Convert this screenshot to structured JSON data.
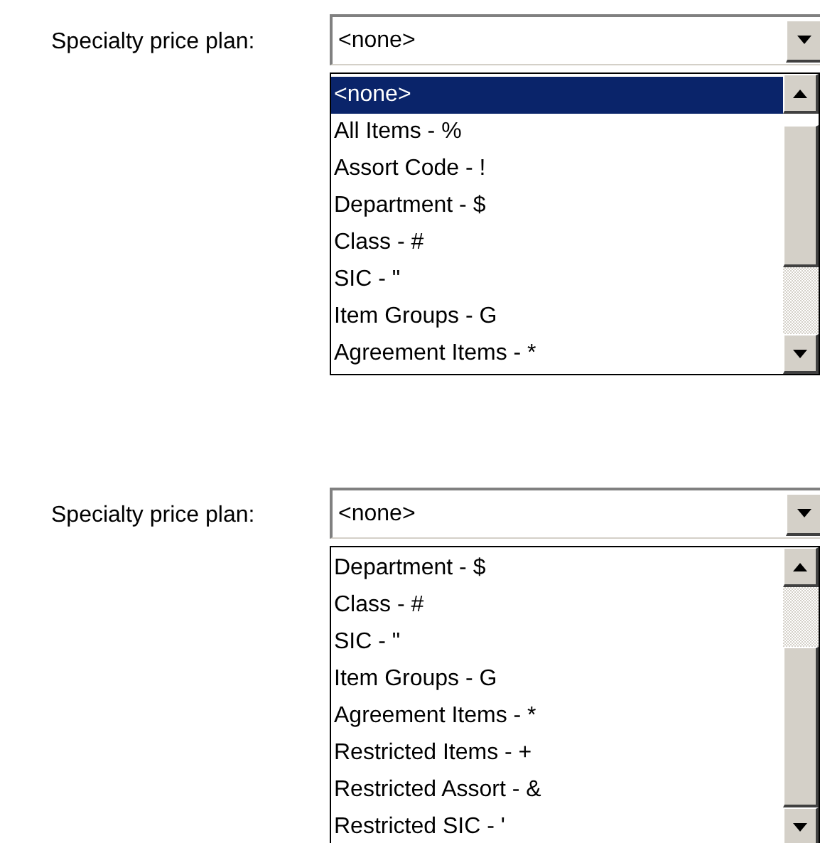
{
  "panels": [
    {
      "label": "Specialty price plan:",
      "value": "<none>",
      "options": [
        {
          "text": "<none>",
          "selected": true
        },
        {
          "text": "All Items - %",
          "selected": false
        },
        {
          "text": "Assort Code - !",
          "selected": false
        },
        {
          "text": "Department - $",
          "selected": false
        },
        {
          "text": "Class - #",
          "selected": false
        },
        {
          "text": "SIC - \"",
          "selected": false
        },
        {
          "text": "Item Groups - G",
          "selected": false
        },
        {
          "text": "Agreement Items - *",
          "selected": false
        }
      ]
    },
    {
      "label": "Specialty price plan:",
      "value": "<none>",
      "options": [
        {
          "text": "Department - $",
          "selected": false
        },
        {
          "text": "Class - #",
          "selected": false
        },
        {
          "text": "SIC - \"",
          "selected": false
        },
        {
          "text": "Item Groups - G",
          "selected": false
        },
        {
          "text": "Agreement Items - *",
          "selected": false
        },
        {
          "text": "Restricted Items - +",
          "selected": false
        },
        {
          "text": "Restricted Assort - &",
          "selected": false
        },
        {
          "text": "Restricted SIC - '",
          "selected": false
        }
      ]
    }
  ]
}
